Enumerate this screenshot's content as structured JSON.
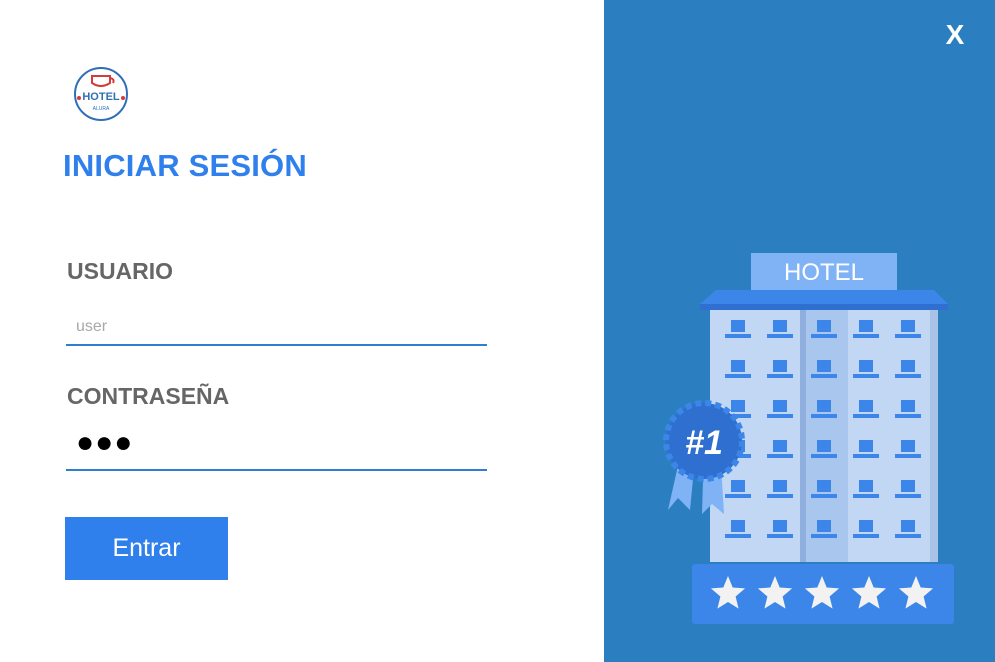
{
  "logo": {
    "text": "HOTEL",
    "subtext": "ALURA"
  },
  "login": {
    "title": "INICIAR SESIÓN",
    "username_label": "USUARIO",
    "username_placeholder": "user",
    "password_label": "CONTRASEÑA",
    "password_value": "●●●",
    "submit_label": "Entrar"
  },
  "window": {
    "close_label": "X"
  },
  "illustration": {
    "sign_text": "HOTEL",
    "badge_text": "#1",
    "stars": 5
  },
  "colors": {
    "accent": "#2f80ed",
    "panel": "#2b7fc1",
    "label": "#666666"
  }
}
